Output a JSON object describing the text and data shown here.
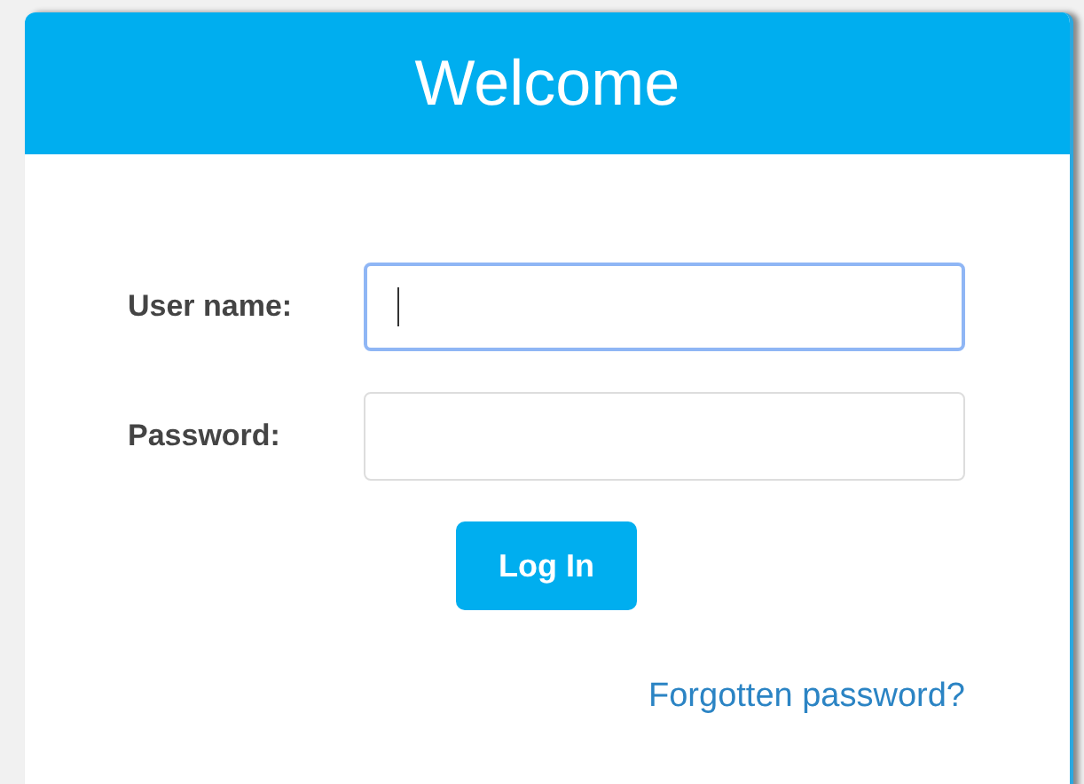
{
  "header": {
    "title": "Welcome"
  },
  "fields": [
    {
      "label": "User name:",
      "focused": true
    },
    {
      "label": "Password:",
      "focused": false
    }
  ],
  "button": {
    "label": "Log In"
  },
  "link": "Forgotten password?"
}
